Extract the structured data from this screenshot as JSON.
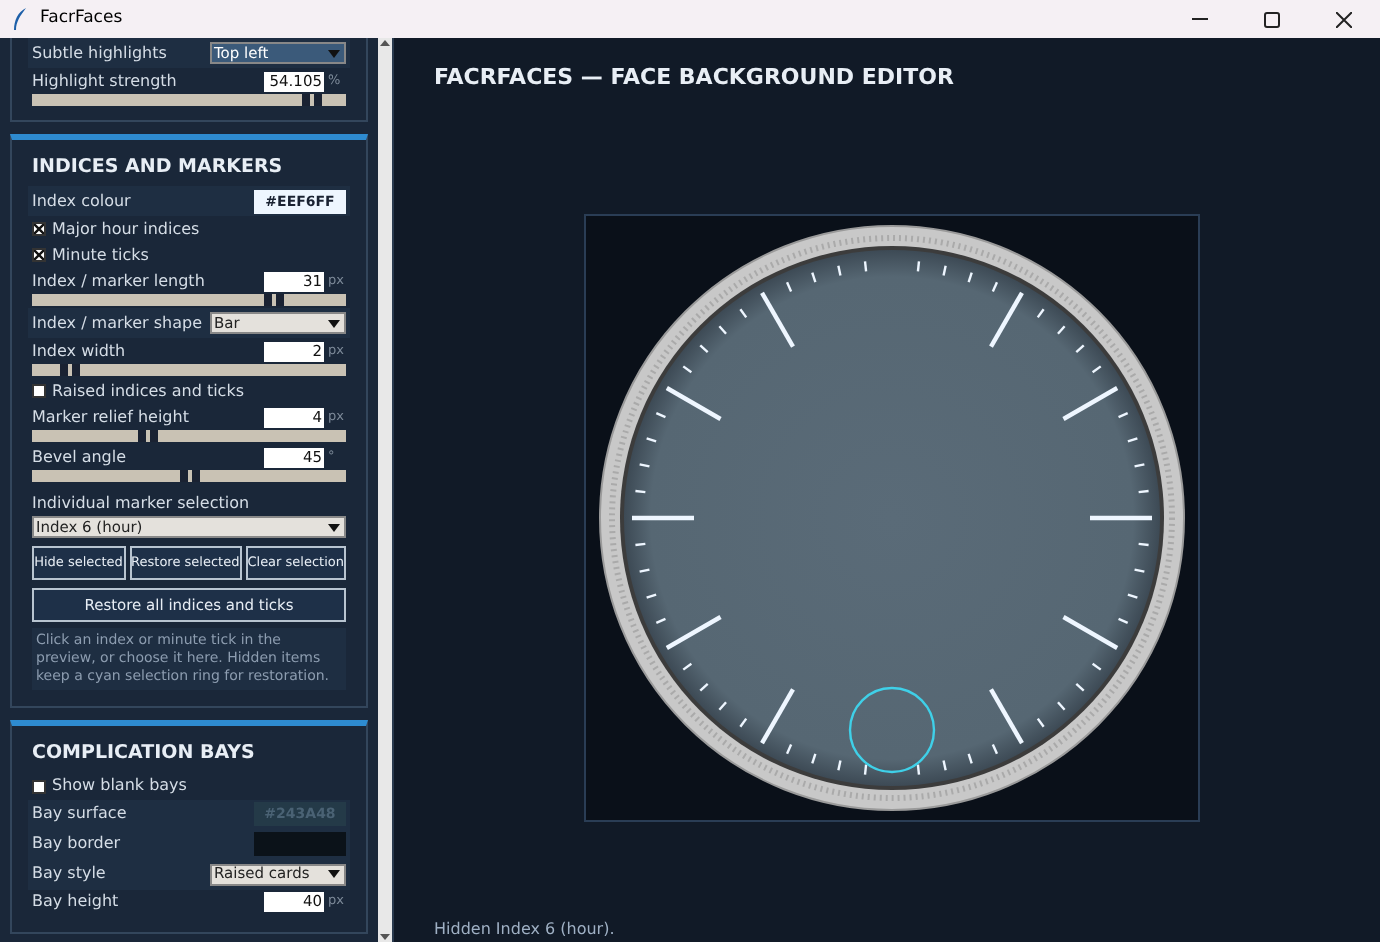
{
  "window": {
    "title": "FacrFaces"
  },
  "sidebar": {
    "sections": [
      {
        "rows": [
          {
            "kind": "select",
            "label": "Subtle highlights",
            "value": "Top left",
            "focused": true
          },
          {
            "kind": "slider",
            "label": "Highlight strength",
            "value": "54.105",
            "unit": "%",
            "level": 0.89
          }
        ]
      },
      {
        "heading": "INDICES AND MARKERS",
        "rows": [
          {
            "kind": "color",
            "label": "Index colour",
            "value": "#EEF6FF",
            "color": "#eef6ff"
          },
          {
            "kind": "checkbox",
            "label": "Major hour indices",
            "checked": true
          },
          {
            "kind": "checkbox",
            "label": "Minute ticks",
            "checked": true
          },
          {
            "kind": "slider",
            "label": "Index / marker length",
            "value": "31",
            "unit": "px",
            "level": 0.77
          },
          {
            "kind": "select",
            "label": "Index / marker shape",
            "value": "Bar",
            "focused": false
          },
          {
            "kind": "slider",
            "label": "Index width",
            "value": "2",
            "unit": "px",
            "level": 0.12
          },
          {
            "kind": "checkbox",
            "label": "Raised indices and ticks",
            "checked": false
          },
          {
            "kind": "slider",
            "label": "Marker relief height",
            "value": "4",
            "unit": "px",
            "level": 0.37
          },
          {
            "kind": "slider",
            "label": "Bevel angle",
            "value": "45",
            "unit": "°",
            "level": 0.5
          },
          {
            "kind": "heading",
            "label": "Individual marker selection"
          },
          {
            "kind": "wide-select",
            "value": "Index 6 (hour)"
          },
          {
            "kind": "buttons",
            "buttons": [
              "Hide selected",
              "Restore selected",
              "Clear selection"
            ]
          },
          {
            "kind": "wide-button",
            "label": "Restore all indices and ticks"
          },
          {
            "kind": "note",
            "text": "Click an index or minute tick in the preview, or choose it here. Hidden items keep a cyan selection ring for restoration."
          }
        ]
      },
      {
        "heading": "COMPLICATION BAYS",
        "rows": [
          {
            "kind": "checkbox",
            "label": "Show blank bays",
            "checked": false
          },
          {
            "kind": "color",
            "label": "Bay surface",
            "value": "#243A48",
            "color": "#243a48"
          },
          {
            "kind": "color",
            "label": "Bay border",
            "color": "#0b1219"
          },
          {
            "kind": "select",
            "label": "Bay style",
            "value": "Raised cards",
            "focused": false
          },
          {
            "kind": "number",
            "label": "Bay height",
            "value": "40",
            "unit": "px"
          }
        ]
      }
    ]
  },
  "main": {
    "title": "FACRFACES — FACE BACKGROUND EDITOR",
    "status": "Hidden Index 6 (hour)."
  }
}
